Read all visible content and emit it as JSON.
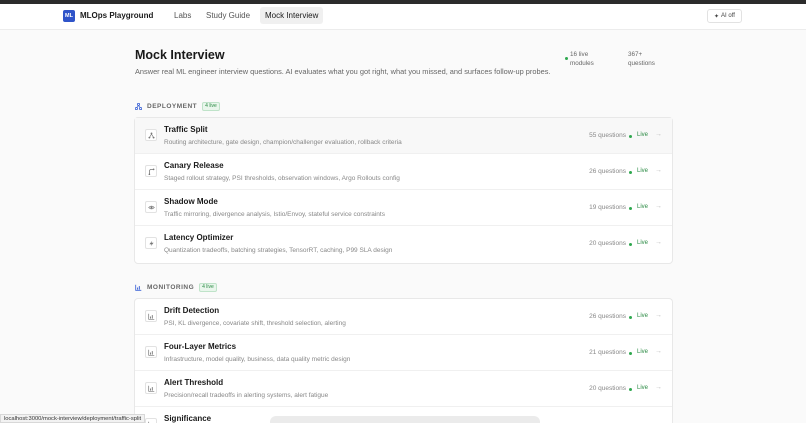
{
  "nav": {
    "logo_text": "ML",
    "brand": "MLOps Playground",
    "links": [
      "Labs",
      "Study Guide",
      "Mock Interview"
    ],
    "active": "Mock Interview",
    "ai_toggle": "AI off"
  },
  "page": {
    "title": "Mock Interview",
    "subtitle": "Answer real ML engineer interview questions. AI evaluates what you got right, what you missed, and surfaces follow-up probes.",
    "stats": {
      "modules_line1": "16 live",
      "modules_line2": "modules",
      "questions_line1": "367+",
      "questions_line2": "questions"
    }
  },
  "sections": [
    {
      "label": "DEPLOYMENT",
      "badge": "4 live",
      "icon": "deployment-icon",
      "items": [
        {
          "title": "Traffic Split",
          "desc": "Routing architecture, gate design, champion/challenger evaluation, rollback criteria",
          "count": "55 questions",
          "status": "Live",
          "icon": "split-icon"
        },
        {
          "title": "Canary Release",
          "desc": "Staged rollout strategy, PSI thresholds, observation windows, Argo Rollouts config",
          "count": "26 questions",
          "status": "Live",
          "icon": "canary-icon"
        },
        {
          "title": "Shadow Mode",
          "desc": "Traffic mirroring, divergence analysis, Istio/Envoy, stateful service constraints",
          "count": "19 questions",
          "status": "Live",
          "icon": "eye-icon"
        },
        {
          "title": "Latency Optimizer",
          "desc": "Quantization tradeoffs, batching strategies, TensorRT, caching, P99 SLA design",
          "count": "20 questions",
          "status": "Live",
          "icon": "bolt-icon"
        }
      ]
    },
    {
      "label": "MONITORING",
      "badge": "4 live",
      "icon": "chart-icon",
      "items": [
        {
          "title": "Drift Detection",
          "desc": "PSI, KL divergence, covariate shift, threshold selection, alerting",
          "count": "26 questions",
          "status": "Live",
          "icon": "chart-icon"
        },
        {
          "title": "Four-Layer Metrics",
          "desc": "Infrastructure, model quality, business, data quality metric design",
          "count": "21 questions",
          "status": "Live",
          "icon": "chart-icon"
        },
        {
          "title": "Alert Threshold",
          "desc": "Precision/recall tradeoffs in alerting systems, alert fatigue",
          "count": "20 questions",
          "status": "Live",
          "icon": "chart-icon"
        },
        {
          "title": "Significance",
          "desc": "",
          "count": "",
          "status": "",
          "icon": "chart-icon"
        }
      ]
    }
  ],
  "status_bar": "localhost:3000/mock-interview/deployment/traffic-split",
  "colors": {
    "accent": "#2f54c9",
    "live": "#2fa84f"
  }
}
